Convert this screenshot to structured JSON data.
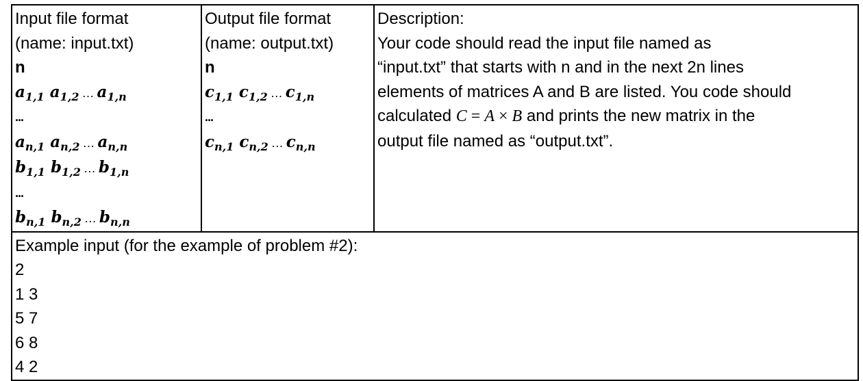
{
  "input_col": {
    "header_line1": "Input file format",
    "header_line2": "(name: input.txt)",
    "n": "n",
    "dots": "…",
    "vdots": "...",
    "rows": [
      {
        "sym": "a",
        "s1": "1,1",
        "s2": "1,2",
        "s3": "1,n"
      },
      {
        "sym": "a",
        "s1": "n,1",
        "s2": "n,2",
        "s3": "n,n"
      },
      {
        "sym": "b",
        "s1": "1,1",
        "s2": "1,2",
        "s3": "1,n"
      },
      {
        "sym": "b",
        "s1": "n,1",
        "s2": "n,2",
        "s3": "n,n"
      }
    ]
  },
  "output_col": {
    "header_line1": "Output file format",
    "header_line2": "(name: output.txt)",
    "n": "n",
    "dots": "…",
    "vdots": "...",
    "rows": [
      {
        "sym": "c",
        "s1": "1,1",
        "s2": "1,2",
        "s3": "1,n"
      },
      {
        "sym": "c",
        "s1": "n,1",
        "s2": "n,2",
        "s3": "n,n"
      }
    ]
  },
  "description": {
    "title": "Description:",
    "line1": "Your code should read the input file named as",
    "line2": "“input.txt” that starts with n and in the next 2n lines",
    "line3": "elements of matrices A and B are listed. You code should",
    "line4_pre": "calculated ",
    "eq_C": "C",
    "eq_equals": " = ",
    "eq_A": "A",
    "eq_times": " × ",
    "eq_B": "B",
    "line4_post": " and prints the new matrix in the",
    "line5": "output file named as “output.txt”."
  },
  "example": {
    "title": "Example input (for the example of problem #2):",
    "lines": [
      "2",
      "1 3",
      "5 7",
      "6 8",
      "4 2"
    ]
  }
}
